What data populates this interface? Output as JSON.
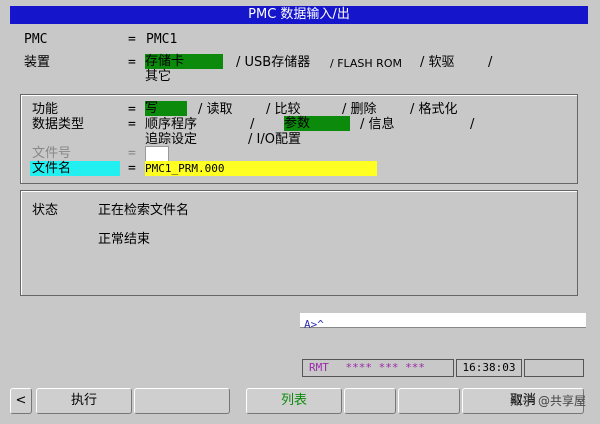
{
  "title": "PMC 数据输入/出",
  "pmc": {
    "label": "PMC",
    "eq": "=",
    "value": "PMC1"
  },
  "device": {
    "label": "装置",
    "eq": "=",
    "options": [
      "存储卡",
      "/ USB存储器",
      "/ FLASH ROM",
      "/ 软驱",
      "/"
    ],
    "extra": "其它"
  },
  "function": {
    "label": "功能",
    "eq": "=",
    "options": [
      "写",
      "/ 读取",
      "/ 比较",
      "/ 删除",
      "/ 格式化"
    ]
  },
  "datatype": {
    "label": "数据类型",
    "eq": "=",
    "options": [
      "顺序程序",
      "/",
      "参数",
      "/ 信息",
      "/"
    ],
    "extra": "追踪设定",
    "extra2": "/ I/O配置"
  },
  "fileno": {
    "label": "文件号",
    "eq": "="
  },
  "filename": {
    "label": "文件名",
    "eq": "=",
    "value": "PMC1_PRM.000"
  },
  "status": {
    "label": "状态",
    "line1": "正在检索文件名",
    "line2": "正常结束"
  },
  "input_prompt": "A>^",
  "mode": {
    "rmt": "RMT",
    "stars": "**** *** ***",
    "time": "16:38:03"
  },
  "softkeys": {
    "left_arrow": "<",
    "k1": "执行",
    "k3": "列表",
    "k6": "取消"
  },
  "watermark": "知乎 @共享屋",
  "colors": {
    "title_bg": "#1515cc",
    "selected": "#0c8a0c",
    "filename_bg": "#ffff22",
    "label_hl": "#22f0f0"
  }
}
